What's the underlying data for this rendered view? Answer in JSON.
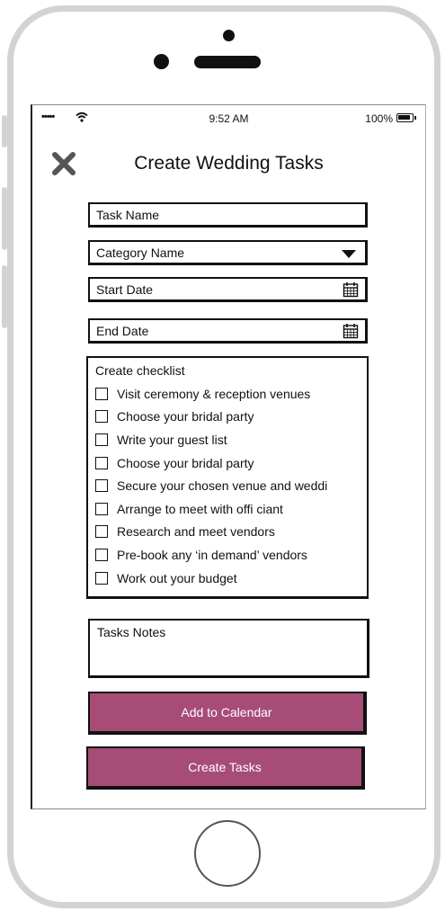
{
  "status_bar": {
    "signal": "•••••",
    "time": "9:52 AM",
    "battery": "100%"
  },
  "header": {
    "title": "Create Wedding Tasks",
    "close_icon": "close-x-icon"
  },
  "form": {
    "task_name": "Task Name",
    "category_name": "Category Name",
    "start_date": "Start Date",
    "end_date": "End Date"
  },
  "checklist": {
    "title": "Create checklist",
    "items": [
      {
        "label": "Visit ceremony & reception venues",
        "checked": false
      },
      {
        "label": "Choose your bridal party",
        "checked": false
      },
      {
        "label": "Write your guest list",
        "checked": false
      },
      {
        "label": "Choose your bridal party",
        "checked": false
      },
      {
        "label": "Secure your chosen venue and weddi",
        "checked": false
      },
      {
        "label": "Arrange to meet with offi ciant",
        "checked": false
      },
      {
        "label": "Research and meet vendors",
        "checked": false
      },
      {
        "label": "Pre-book any ‘in demand’ vendors",
        "checked": false
      },
      {
        "label": "Work out your budget",
        "checked": false
      }
    ]
  },
  "notes": {
    "label": "Tasks Notes"
  },
  "buttons": {
    "add_to_calendar": "Add to Calendar",
    "create_tasks": "Create Tasks"
  },
  "colors": {
    "button_accent": "#a74c77",
    "phone_frame": "#d3d3d3"
  }
}
